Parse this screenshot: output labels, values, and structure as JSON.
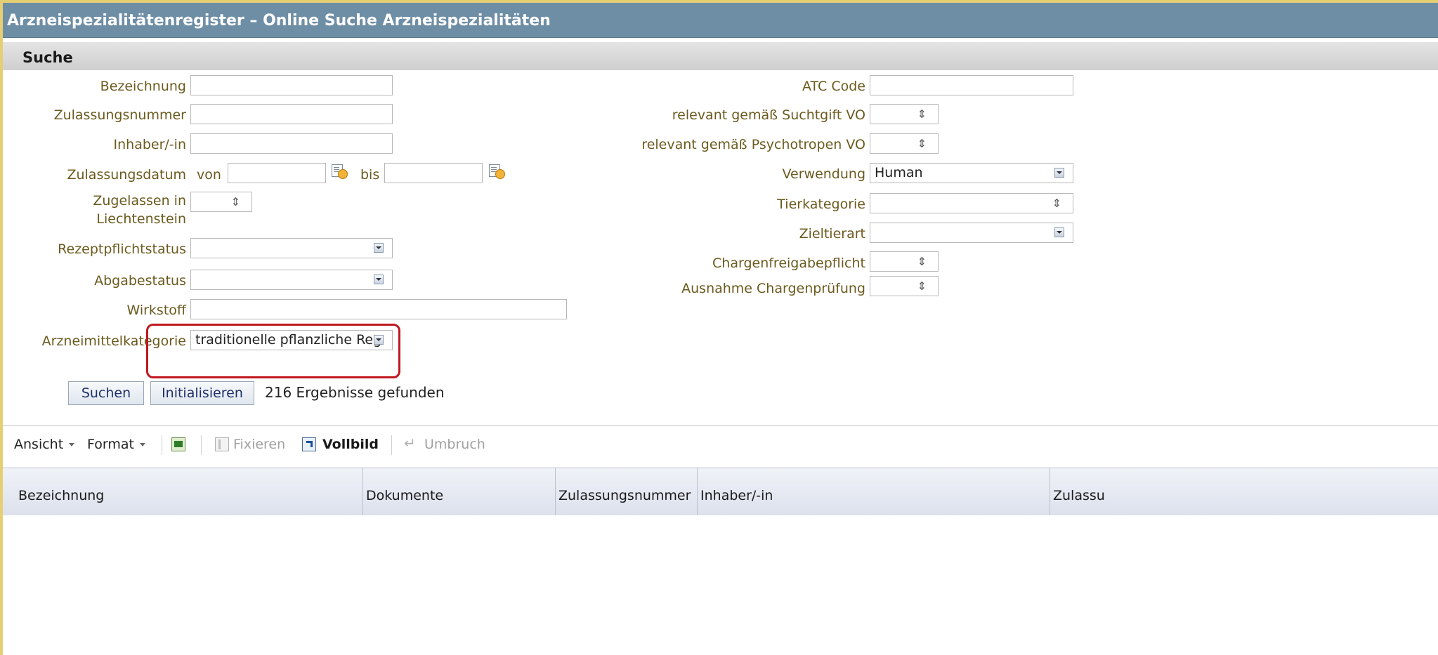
{
  "title": "Arzneispezialitätenregister – Online Suche Arzneispezialitäten",
  "section": "Suche",
  "left_fields": {
    "bezeichnung": {
      "label": "Bezeichnung",
      "value": ""
    },
    "zulassungsnummer": {
      "label": "Zulassungsnummer",
      "value": ""
    },
    "inhaber": {
      "label": "Inhaber/-in",
      "value": ""
    },
    "zulassungsdatum": {
      "label": "Zulassungsdatum",
      "von_label": "von",
      "bis_label": "bis",
      "von_value": "",
      "bis_value": ""
    },
    "zugelassen": {
      "label": "Zugelassen in Liechtenstein",
      "value": ""
    },
    "rezeptpflichtstatus": {
      "label": "Rezeptpflichtstatus",
      "value": ""
    },
    "abgabestatus": {
      "label": "Abgabestatus",
      "value": ""
    },
    "wirkstoff": {
      "label": "Wirkstoff",
      "value": ""
    },
    "arzneimittelkategorie": {
      "label": "Arzneimittelkategorie",
      "value": "traditionelle pflanzliche Reg"
    }
  },
  "right_fields": {
    "atc": {
      "label": "ATC Code",
      "value": ""
    },
    "suchtgift": {
      "label": "relevant gemäß Suchtgift VO",
      "value": ""
    },
    "psychotropen": {
      "label": "relevant gemäß Psychotropen VO",
      "value": ""
    },
    "verwendung": {
      "label": "Verwendung",
      "value": "Human"
    },
    "tierkategorie": {
      "label": "Tierkategorie",
      "value": ""
    },
    "zieltierart": {
      "label": "Zieltierart",
      "value": ""
    },
    "chargenfreigabepflicht": {
      "label": "Chargenfreigabepflicht",
      "value": ""
    },
    "ausnahme": {
      "label": "Ausnahme Chargenprüfung",
      "value": ""
    }
  },
  "buttons": {
    "search": "Suchen",
    "reset": "Initialisieren"
  },
  "result_text": "216 Ergebnisse gefunden",
  "toolbar": {
    "ansicht": "Ansicht",
    "format": "Format",
    "fixieren": "Fixieren",
    "vollbild": "Vollbild",
    "umbruch": "Umbruch"
  },
  "table": {
    "columns": [
      "Bezeichnung",
      "Dokumente",
      "Zulassungsnummer",
      "Inhaber/-in",
      "Zulassu"
    ]
  },
  "colors": {
    "title_bar": "#6e8ea6",
    "label": "#6b5a1e",
    "highlight": "#c0181f"
  }
}
